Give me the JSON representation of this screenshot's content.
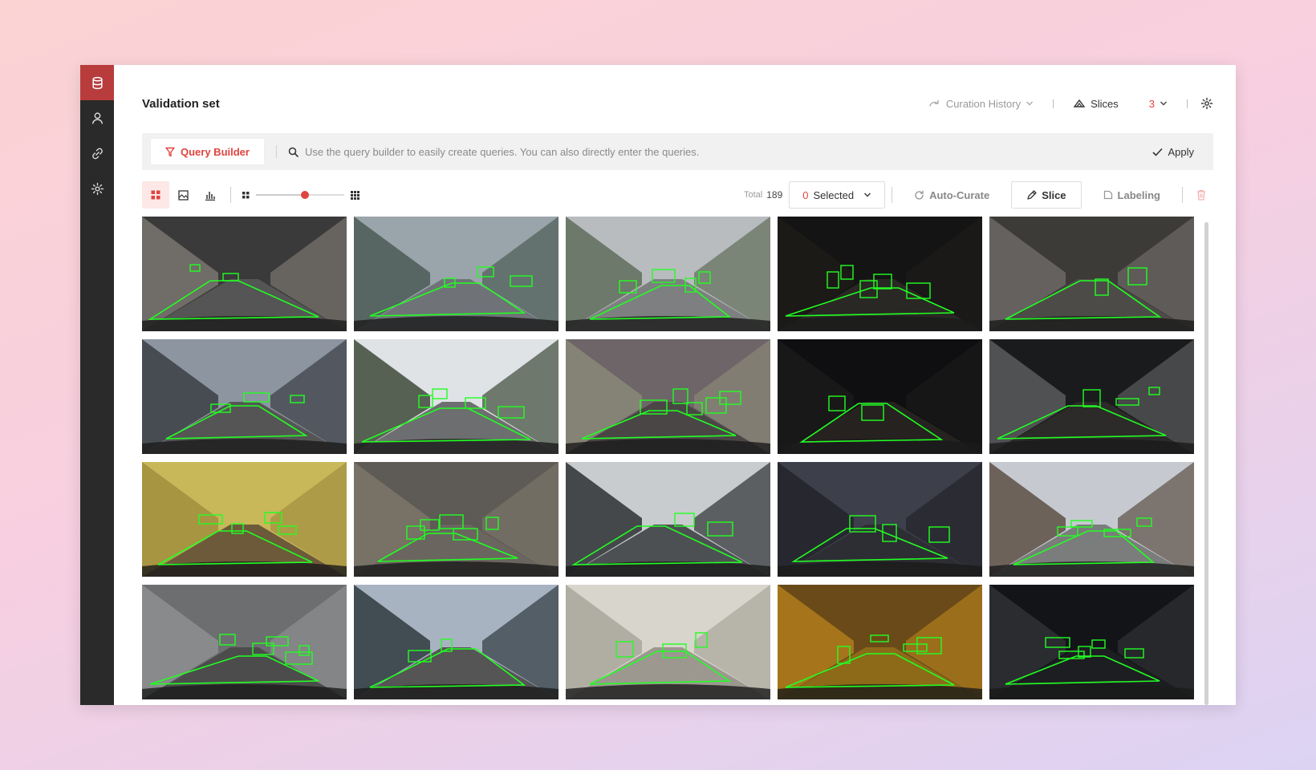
{
  "sidebar": {
    "items": [
      {
        "icon": "database-icon",
        "active": true
      },
      {
        "icon": "user-icon",
        "active": false
      },
      {
        "icon": "link-icon",
        "active": false
      },
      {
        "icon": "gear-icon",
        "active": false
      }
    ]
  },
  "header": {
    "title": "Validation set",
    "curation_history": "Curation History",
    "slices": "Slices",
    "slices_count": "3"
  },
  "query": {
    "builder_label": "Query Builder",
    "placeholder": "Use the query builder to easily create queries. You can also directly enter the queries.",
    "apply_label": "Apply"
  },
  "toolbar": {
    "total_label": "Total",
    "total_count": "189",
    "selected_count": "0",
    "selected_label": "Selected",
    "auto_curate": "Auto-Curate",
    "slice": "Slice",
    "labeling": "Labeling",
    "thumb_size_level": 0.55
  },
  "colors": {
    "accent": "#e0443e",
    "sidebar_active": "#b83c3c",
    "annotation": "#22ff22"
  },
  "thumbnails": [
    {
      "scene": "tunnel",
      "sky": "#3a3a3a",
      "road": "#555",
      "wall": "#7a7670"
    },
    {
      "scene": "foggy-street",
      "sky": "#9aa4ab",
      "road": "#6f7377",
      "wall": "#4b5c55"
    },
    {
      "scene": "overcast-street",
      "sky": "#b8bcbf",
      "road": "#7d7f80",
      "wall": "#5f6d5a"
    },
    {
      "scene": "night-road",
      "sky": "#141414",
      "road": "#2a2824",
      "wall": "#1d1b18"
    },
    {
      "scene": "tunnel",
      "sky": "#3d3b38",
      "road": "#4d4b48",
      "wall": "#6c6966"
    },
    {
      "scene": "underpass",
      "sky": "#8c95a0",
      "road": "#555",
      "wall": "#3b3f45"
    },
    {
      "scene": "city-street",
      "sky": "#dfe3e6",
      "road": "#6d6e70",
      "wall": "#3f4a38"
    },
    {
      "scene": "tunnel-lights",
      "sky": "#6d6567",
      "road": "#4a4646",
      "wall": "#8a8878"
    },
    {
      "scene": "night-street",
      "sky": "#0f0f12",
      "road": "#25221f",
      "wall": "#1b1a1a"
    },
    {
      "scene": "night-trucks",
      "sky": "#1a1b1d",
      "road": "#2c2b29",
      "wall": "#5a5b5c"
    },
    {
      "scene": "graffiti-tunnel",
      "sky": "#c8b85a",
      "road": "#6d5a3a",
      "wall": "#a28e3e"
    },
    {
      "scene": "concrete-tunnel",
      "sky": "#5e5a55",
      "road": "#6a665f",
      "wall": "#7b756a"
    },
    {
      "scene": "rainy-sidewalk",
      "sky": "#c9cccf",
      "road": "#4d5053",
      "wall": "#2d3033"
    },
    {
      "scene": "dusk-highway",
      "sky": "#3d3f4a",
      "road": "#2d2e33",
      "wall": "#23252a"
    },
    {
      "scene": "taxis",
      "sky": "#c6cad0",
      "road": "#7b7c7c",
      "wall": "#5d5045"
    },
    {
      "scene": "dark-tunnel",
      "sky": "#6c6e70",
      "road": "#4c4c4c",
      "wall": "#8d8f91"
    },
    {
      "scene": "bridge",
      "sky": "#a8b3c2",
      "road": "#555",
      "wall": "#2f3a40"
    },
    {
      "scene": "hazy-trees",
      "sky": "#d8d5cd",
      "road": "#9c9890",
      "wall": "#a9a69b"
    },
    {
      "scene": "orange-tunnel",
      "sky": "#6a4a18",
      "road": "#8c6a18",
      "wall": "#b07d1c"
    },
    {
      "scene": "night-city",
      "sky": "#121418",
      "road": "#1d1e21",
      "wall": "#2f3035"
    }
  ]
}
